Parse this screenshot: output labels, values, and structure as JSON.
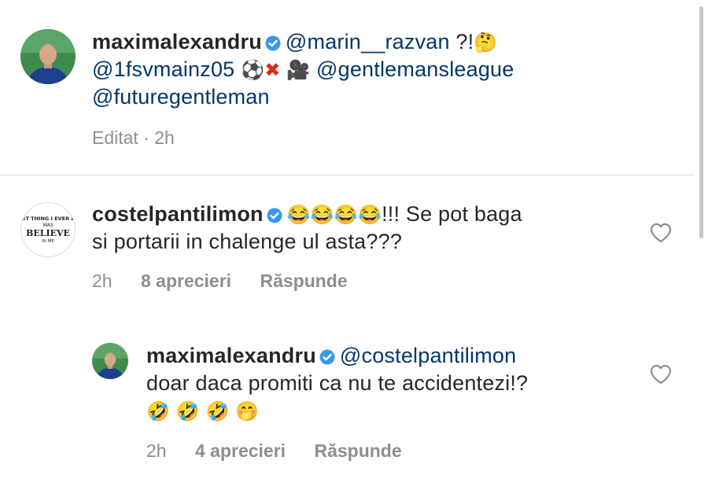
{
  "caption": {
    "username": "maximalexandru",
    "text_1": "@marin__razvan",
    "text_2": " ?!",
    "mention_mainz": "@1fsvmainz05",
    "mention_gl": "@gentlemansleague",
    "mention_fg": "@futuregentleman",
    "meta": "Editat · 2h",
    "emoji": [
      "thinking-face",
      "soccer-ball",
      "cross-mark",
      "movie-camera"
    ]
  },
  "comment": {
    "username": "costelpantilimon",
    "text_1": "!!! Se pot baga",
    "text_2": "si portarii in chalenge ul  asta???",
    "time": "2h",
    "likes": "8 aprecieri",
    "reply": "Răspunde",
    "avatar_text": [
      "BEST THING I EVER DID",
      "WAS",
      "BELIEVE",
      "IN ME"
    ],
    "emoji": [
      "tears-of-joy",
      "tears-of-joy",
      "tears-of-joy",
      "tears-of-joy"
    ]
  },
  "reply": {
    "username": "maximalexandru",
    "mention": "@costelpantilimon",
    "text_1": "doar daca promiti ca nu te accidentezi!?",
    "time": "2h",
    "likes": "4 aprecieri",
    "reply": "Răspunde",
    "emoji": [
      "rofl",
      "rofl",
      "rofl",
      "shushing-face"
    ]
  },
  "colors": {
    "text": "#262626",
    "mention": "#00376b",
    "meta": "#8e8e8e",
    "verified": "#3897f0",
    "divider": "#dbdbdb"
  }
}
